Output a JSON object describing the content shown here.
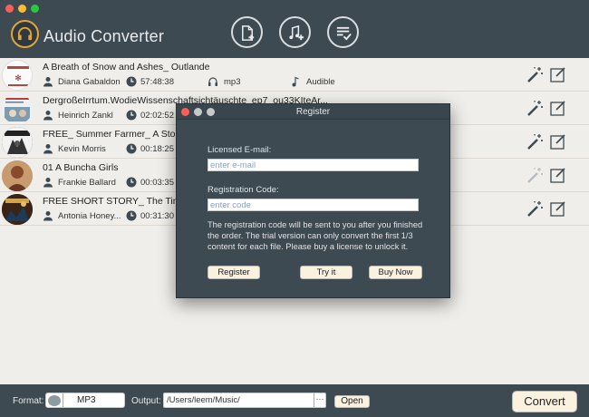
{
  "app": {
    "title": "Audio Converter",
    "header_buttons": [
      {
        "name": "add-files-button",
        "icon": "add-file-icon"
      },
      {
        "name": "add-music-button",
        "icon": "add-music-icon"
      },
      {
        "name": "task-list-button",
        "icon": "task-list-icon"
      }
    ]
  },
  "files": [
    {
      "title": "A Breath of Snow and Ashes_ Outlande",
      "author": "Diana Gabaldon",
      "duration": "57:48:38",
      "format": "mp3",
      "source": "Audible"
    },
    {
      "title": "DergroßeIrrtum.WodieWissenschaftsichtäuschte_ep7_ou33KIteAr...",
      "author": "Heinrich Zankl",
      "duration": "02:02:52"
    },
    {
      "title": "FREE_ Summer Farmer_ A Story fro",
      "author": "Kevin Morris",
      "duration": "00:18:25"
    },
    {
      "title": "01 A Buncha Girls",
      "author": "Frankie Ballard",
      "duration": "00:03:35"
    },
    {
      "title": "FREE SHORT STORY_ The Time Be",
      "author": "Antonia Honey...",
      "duration": "00:31:30"
    }
  ],
  "footer": {
    "format_label": "Format:",
    "format_value": "MP3",
    "output_label": "Output:",
    "output_path": "/Users/leem/Music/",
    "browse_label": "···",
    "open_label": "Open",
    "convert_label": "Convert"
  },
  "dialog": {
    "title": "Register",
    "email_label": "Licensed E-mail:",
    "email_placeholder": "enter e-mail",
    "code_label": "Registration Code:",
    "code_placeholder": "enter code",
    "note": "The registration code will be sent to you after you finished the order. The trial version can only convert the first 1/3 content for each file. Please buy a license to unlock it.",
    "register_label": "Register",
    "try_label": "Try it",
    "buy_label": "Buy Now"
  },
  "colors": {
    "header_bg": "#3d4a52",
    "list_bg": "#efeeea",
    "button_bg": "#fbf1df",
    "logo_ring": "#e0a537"
  }
}
